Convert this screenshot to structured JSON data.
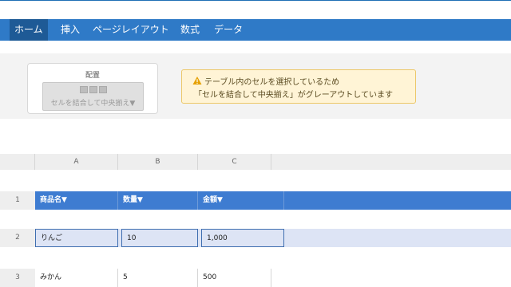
{
  "ribbon": {
    "tabs": [
      "ホーム",
      "挿入",
      "ページレイアウト",
      "数式",
      "データ"
    ],
    "group_title": "配置",
    "merge_button_label": "セルを結合して中央揃え▼",
    "merge_button_state": "disabled"
  },
  "notice": {
    "icon": "warning-icon",
    "line1": "テーブル内のセルを選択しているため",
    "line2": "「セルを結合して中央揃え」がグレーアウトしています"
  },
  "sheet": {
    "column_headers": [
      "A",
      "B",
      "C"
    ],
    "rows": [
      {
        "num": "1",
        "cells": [
          "商品名▼",
          "数量▼",
          "金額▼"
        ]
      },
      {
        "num": "2",
        "cells": [
          "りんご",
          "10",
          "1,000"
        ]
      },
      {
        "num": "3",
        "cells": [
          "みかん",
          "5",
          "500"
        ]
      }
    ]
  },
  "colors": {
    "tab_bar": "#2f7ac7",
    "active_tab": "#1e5a96",
    "table_header": "#3e7cd1",
    "selected_row": "#dde4f5",
    "warning_bg": "#fff4d6",
    "warning_icon": "#e6a100"
  }
}
